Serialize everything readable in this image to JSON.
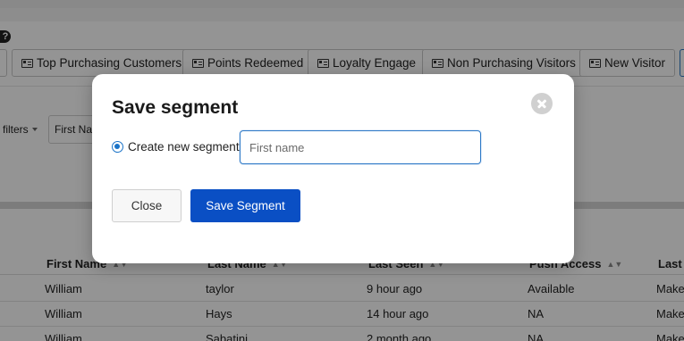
{
  "background": {
    "help_icon": "question-circle-icon",
    "segments": [
      {
        "label": "Top Purchasing Customers",
        "icon": "id-card-icon"
      },
      {
        "label": "Points Redeemed",
        "icon": "id-card-icon"
      },
      {
        "label": "Loyalty Engage",
        "icon": "id-card-icon"
      },
      {
        "label": "Non Purchasing Visitors",
        "icon": "id-card-icon"
      },
      {
        "label": "New Visitor",
        "icon": "id-card-icon"
      }
    ],
    "filters": {
      "more_filters_label": "filters",
      "first_name_chip": "First Nam"
    },
    "table": {
      "columns": [
        "First Name",
        "Last Name",
        "Last Seen",
        "Push Access",
        "Last I"
      ],
      "rows": [
        [
          "William",
          "taylor",
          "9 hour ago",
          "Available",
          "Make"
        ],
        [
          "William",
          "Hays",
          "14 hour ago",
          "NA",
          "Make"
        ],
        [
          "William",
          "Sabatini",
          "2 month ago",
          "NA",
          "Make"
        ]
      ]
    }
  },
  "modal": {
    "title": "Save segment",
    "close_icon": "close-circle-icon",
    "radio_label": "Create new segment",
    "radio_checked": true,
    "name_input": {
      "value": "",
      "placeholder": "First name"
    },
    "close_button": "Close",
    "save_button": "Save Segment"
  },
  "colors": {
    "primary": "#0a4fc4",
    "radio": "#1a73c8",
    "input_focus": "#2d79c7"
  }
}
